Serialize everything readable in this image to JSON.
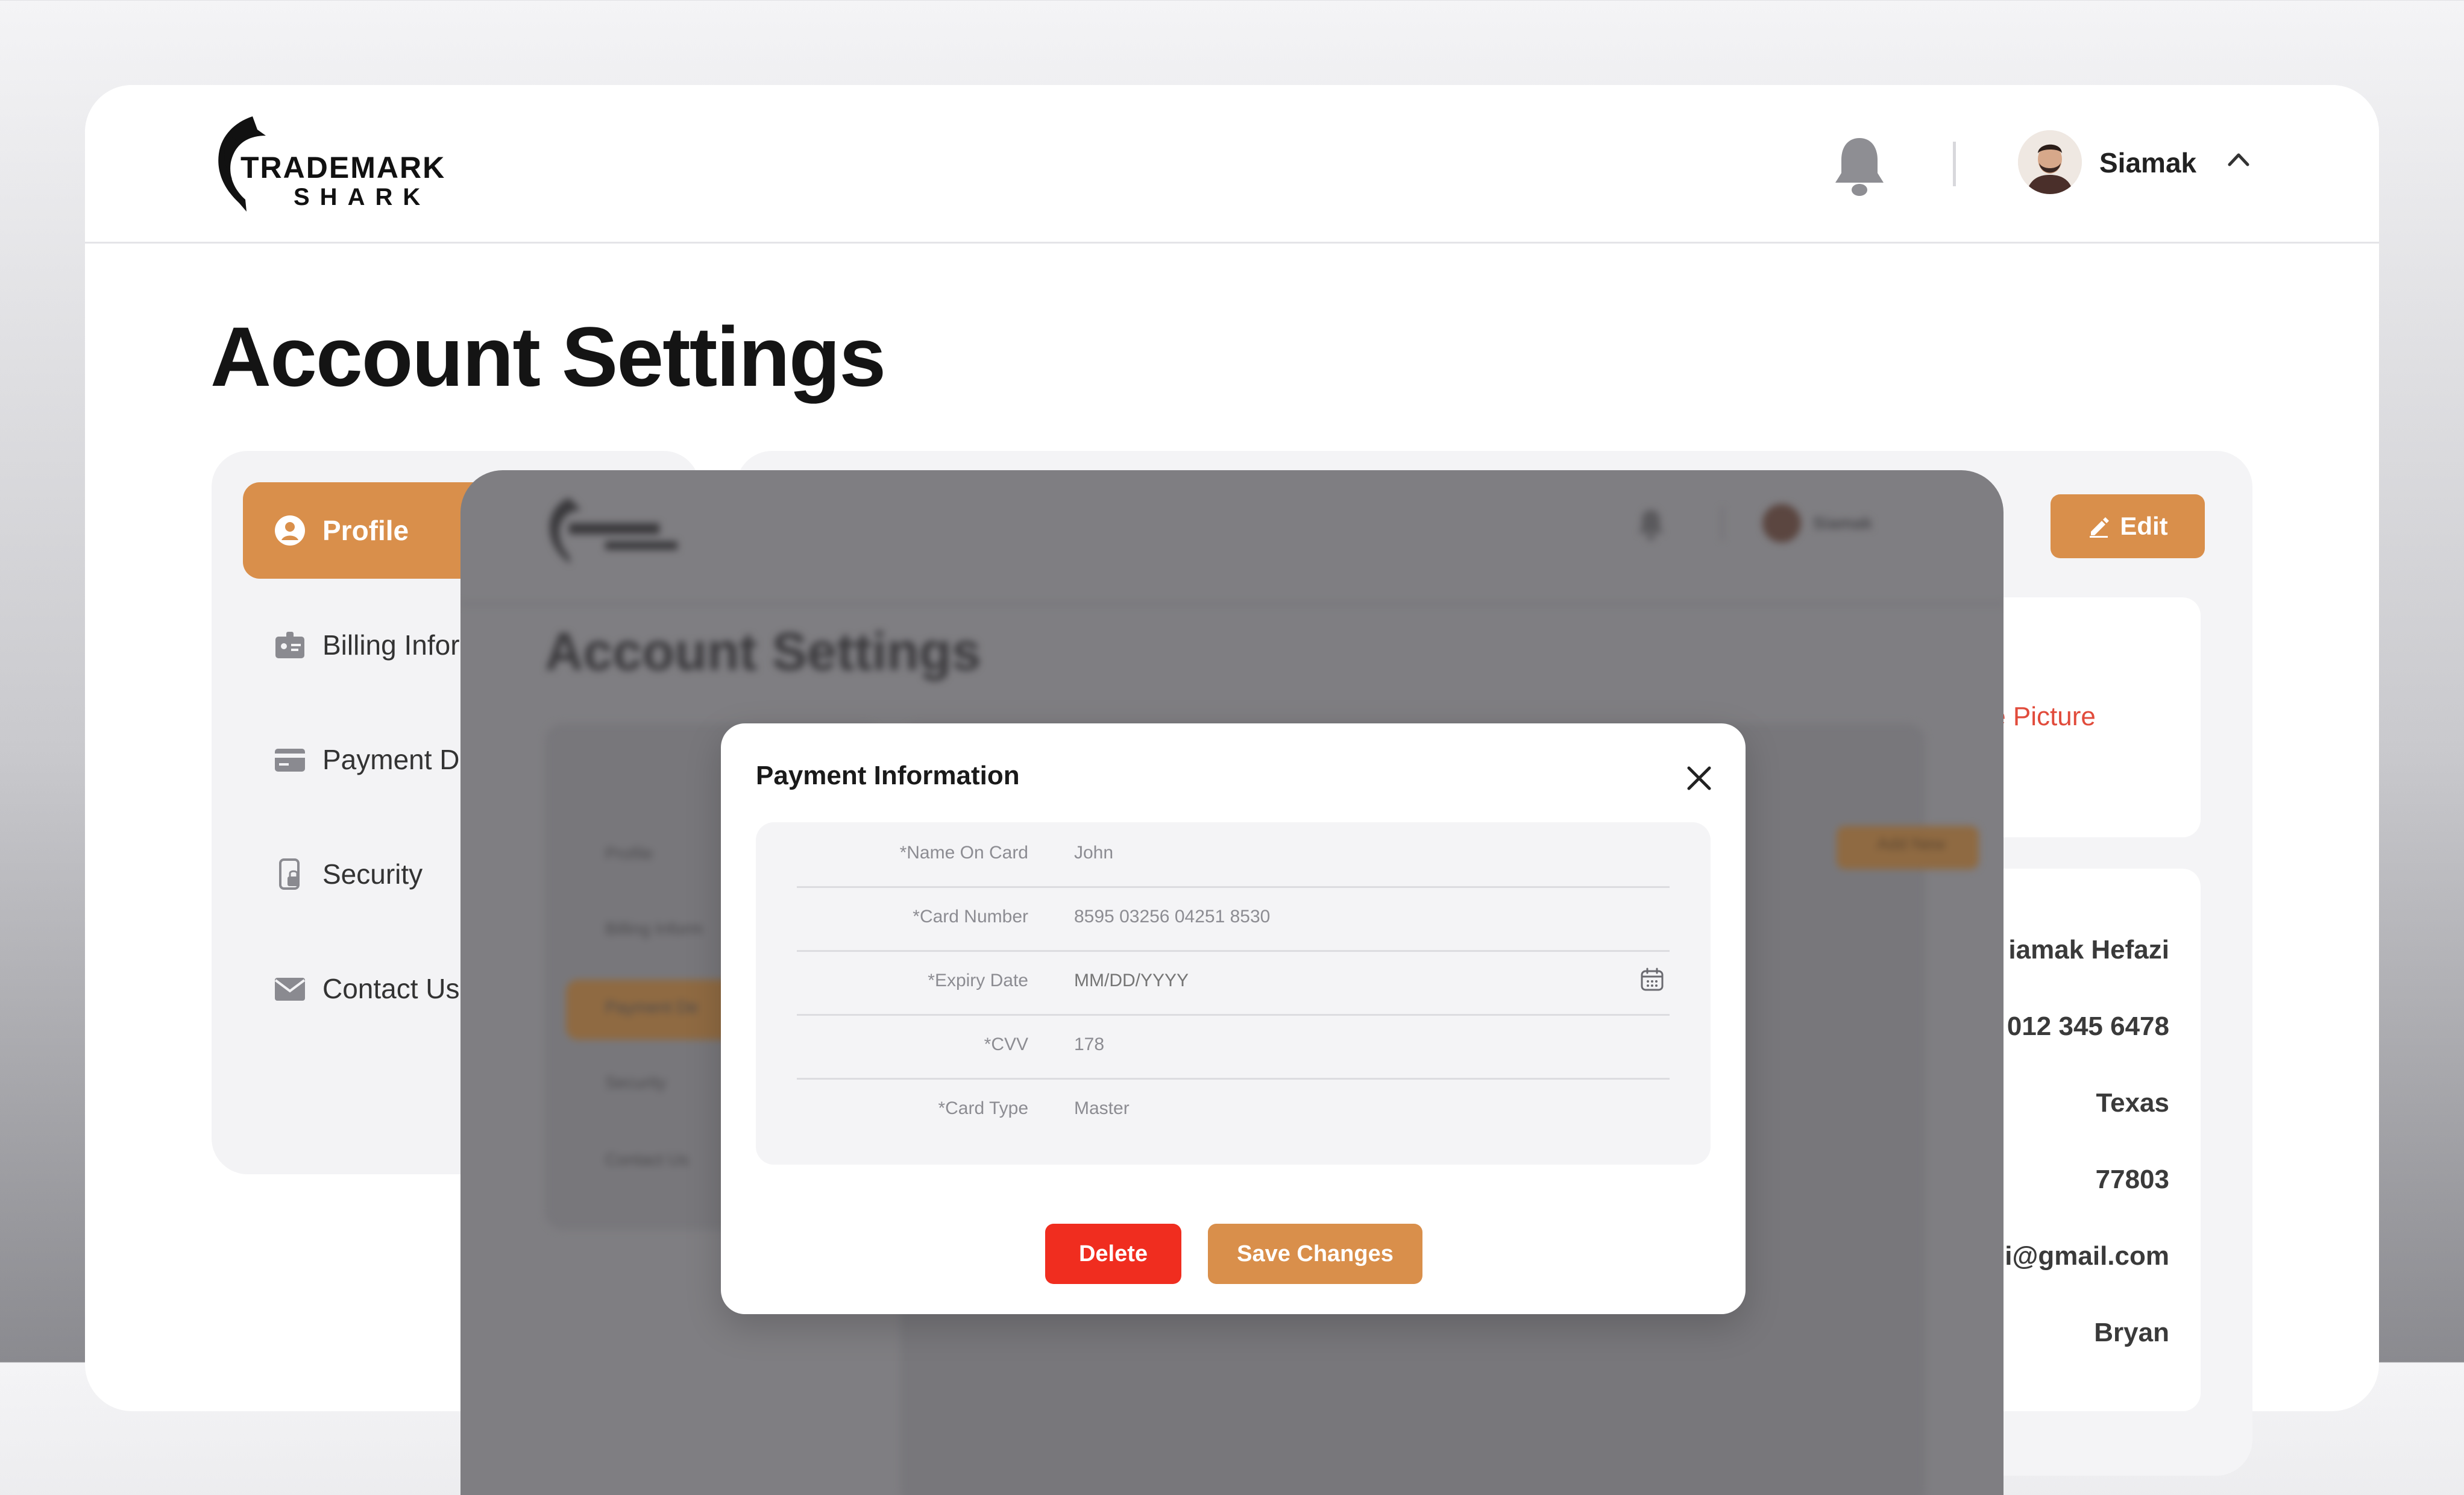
{
  "brand": {
    "line1": "TRADEMARK",
    "line2": "SHARK"
  },
  "header": {
    "user_name": "Siamak"
  },
  "page": {
    "title": "Account Settings"
  },
  "sidebar": {
    "items": [
      {
        "label": "Profile",
        "icon": "user-circle-icon",
        "active": true
      },
      {
        "label": "Billing Infor",
        "icon": "id-card-icon"
      },
      {
        "label": "Payment De",
        "icon": "credit-card-icon"
      },
      {
        "label": "Security",
        "icon": "phone-lock-icon"
      },
      {
        "label": "Contact Us",
        "icon": "envelope-icon"
      }
    ]
  },
  "main": {
    "edit_label": "Edit",
    "delete_picture_label": "te Picture",
    "info_values": [
      "iamak Hefazi",
      "012 345 6478",
      "Texas",
      "77803",
      "i@gmail.com",
      "Bryan"
    ]
  },
  "preview": {
    "title": "Account Settings",
    "user_name": "Siamak",
    "side_items": [
      "Profile",
      "Billing Inform",
      "Payment De",
      "Security",
      "Contact Us"
    ],
    "edit_label": "Add New"
  },
  "modal": {
    "title": "Payment Information",
    "fields": [
      {
        "label": "*Name On Card",
        "value": "John",
        "placeholder": ""
      },
      {
        "label": "*Card Number",
        "value": "8595 03256 04251 8530",
        "placeholder": ""
      },
      {
        "label": "*Expiry Date",
        "value": "",
        "placeholder": "MM/DD/YYYY"
      },
      {
        "label": "*CVV",
        "value": "178",
        "placeholder": ""
      },
      {
        "label": "*Card Type",
        "value": "Master",
        "placeholder": ""
      }
    ],
    "delete_label": "Delete",
    "save_label": "Save Changes"
  },
  "colors": {
    "accent": "#d98f4b",
    "danger": "#f02d1f",
    "danger_text": "#e14b3b"
  }
}
